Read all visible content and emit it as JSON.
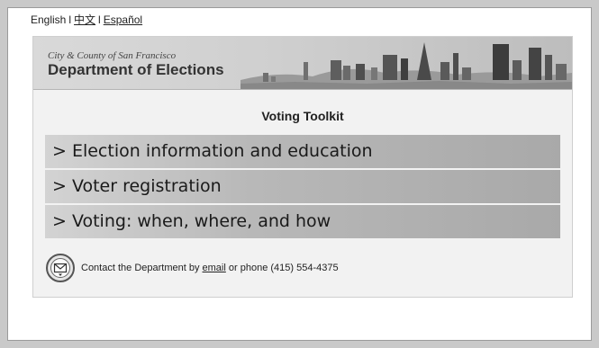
{
  "languages": {
    "english": "English",
    "separator": "l",
    "chinese": "中文",
    "spanish": "Español"
  },
  "banner": {
    "city": "City & County of San Francisco",
    "department": "Department of Elections"
  },
  "toolkit": {
    "title": "Voting Toolkit",
    "items": [
      {
        "label": "> Election information and education"
      },
      {
        "label": "> Voter registration"
      },
      {
        "label": "> Voting: when, where, and how"
      }
    ]
  },
  "contact": {
    "prefix": "Contact the Department by",
    "email_link": "email",
    "suffix": "or phone (415) 554-4375"
  },
  "icons": {
    "contact": "envelope-icon",
    "banner_art": "skyline-image"
  },
  "colors": {
    "page_bg": "#c9c9c9",
    "panel_bg": "#f2f2f2",
    "menu_light": "#d3d3d3",
    "menu_dark": "#a9a9a9"
  }
}
